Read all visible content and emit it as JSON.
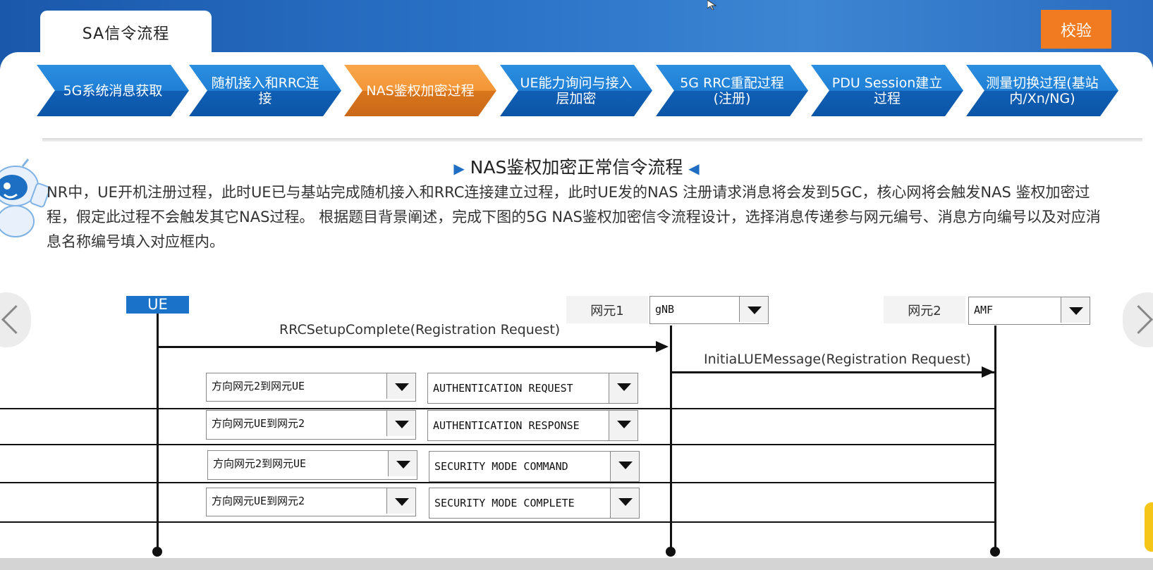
{
  "tab_title": "SA信令流程",
  "verify_button": "校验",
  "steps": [
    {
      "label": "5G系统消息获取",
      "active": false
    },
    {
      "label": "随机接入和RRC连接",
      "active": false
    },
    {
      "label": "NAS鉴权加密过程",
      "active": true
    },
    {
      "label": "UE能力询问与接入层加密",
      "active": false
    },
    {
      "label": "5G RRC重配过程(注册)",
      "active": false
    },
    {
      "label": "PDU Session建立过程",
      "active": false
    },
    {
      "label": "测量切换过程(基站内/Xn/NG)",
      "active": false
    }
  ],
  "section_title": "NAS鉴权加密正常信令流程",
  "description": "NR中，UE开机注册过程，此时UE已与基站完成随机接入和RRC连接建立过程，此时UE发的NAS 注册请求消息将会发到5GC，核心网将会触发NAS 鉴权加密过程，假定此过程不会触发其它NAS过程。 根据题目背景阐述，完成下图的5G NAS鉴权加密信令流程设计，选择消息传递参与网元编号、消息方向编号以及对应消息名称编号填入对应框内。",
  "diagram": {
    "ue_label": "UE",
    "ne1_label": "网元1",
    "ne1_value": "gNB",
    "ne2_label": "网元2",
    "ne2_value": "AMF",
    "msg1": "RRCSetupComplete(Registration Request)",
    "msg2": "InitiaLUEMessage(Registration Request)",
    "rows": [
      {
        "direction": "方向网元2到网元UE",
        "message": "AUTHENTICATION REQUEST"
      },
      {
        "direction": "方向网元UE到网元2",
        "message": "AUTHENTICATION RESPONSE"
      },
      {
        "direction": "方向网元2到网元UE",
        "message": "SECURITY MODE COMMAND"
      },
      {
        "direction": "方向网元UE到网元2",
        "message": "SECURITY MODE COMPLETE"
      }
    ]
  },
  "colors": {
    "accent": "#f07b20",
    "step_blue": "#1f7fd5",
    "step_active": "#f39637",
    "ue_blue": "#1a73c9"
  }
}
